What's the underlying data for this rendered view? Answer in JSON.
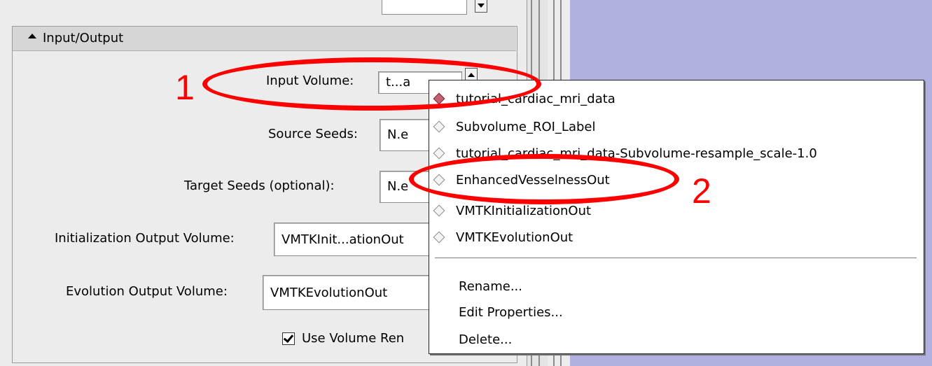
{
  "panel": {
    "section_title": "Input/Output",
    "input_volume": {
      "label": "Input Volume:",
      "value": "t...a"
    },
    "source_seeds": {
      "label": "Source Seeds:",
      "value": "N.e"
    },
    "target_seeds": {
      "label": "Target Seeds (optional):",
      "value": "N.e"
    },
    "init_output": {
      "label": "Initialization Output Volume:",
      "value": "VMTKInit...ationOut"
    },
    "evol_output": {
      "label": "Evolution Output Volume:",
      "value": "VMTKEvolutionOut"
    },
    "use_volume_render": {
      "label": "Use Volume Ren",
      "checked": true
    }
  },
  "menu": {
    "items": [
      {
        "label": "tutorial_cardiac_mri_data",
        "selected": true
      },
      {
        "label": "Subvolume_ROI_Label",
        "selected": false
      },
      {
        "label": "tutorial_cardiac_mri_data-Subvolume-resample_scale-1.0",
        "selected": false
      },
      {
        "label": "EnhancedVesselnessOut",
        "selected": false
      },
      {
        "label": "VMTKInitializationOut",
        "selected": false
      },
      {
        "label": "VMTKEvolutionOut",
        "selected": false
      }
    ],
    "actions": [
      "Rename...",
      "Edit Properties...",
      "Delete..."
    ]
  },
  "annotations": {
    "one": "1",
    "two": "2"
  },
  "colors": {
    "viewer_bg": "#b1b1e1",
    "highlight": "#ff0000",
    "section_header": "#d6d6d6"
  }
}
